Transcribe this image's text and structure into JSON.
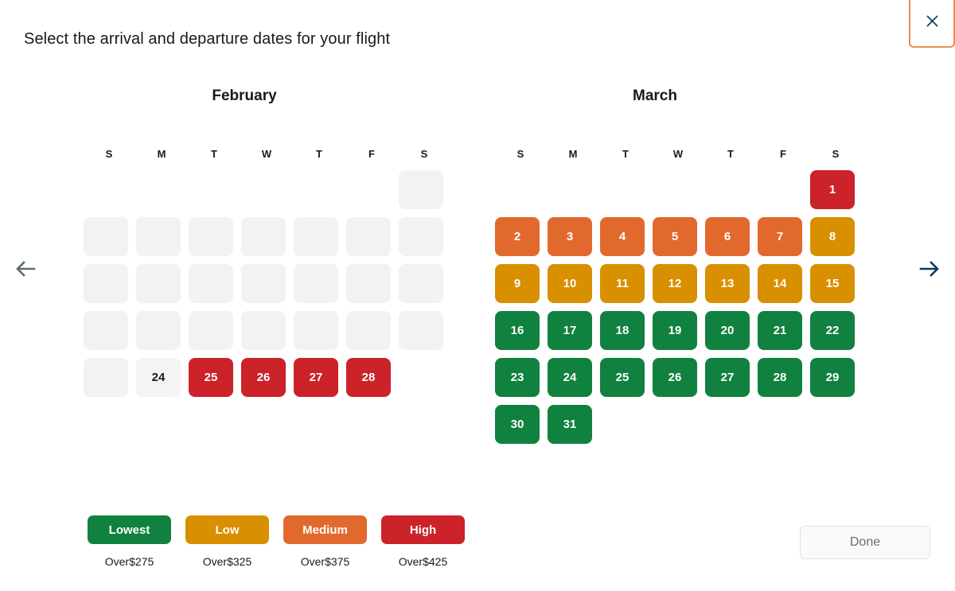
{
  "dialog": {
    "title": "Select the arrival and departure dates for your flight",
    "close_label": "×",
    "done_label": "Done"
  },
  "nav": {
    "prev_label": "←",
    "next_label": "→",
    "prev_enabled": false,
    "next_enabled": true
  },
  "colors": {
    "lowest": "#118140",
    "low": "#d88f00",
    "medium": "#e2692e",
    "high": "#cc2229",
    "empty": "#f2f2f2",
    "disabled_bg": "#f4f4f4",
    "close_border": "#ec8a52",
    "arrow_active": "#0f3c5c",
    "arrow_disabled": "#5f6b6d"
  },
  "weekdays": [
    "S",
    "M",
    "T",
    "W",
    "T",
    "F",
    "S"
  ],
  "months": [
    {
      "name": "February",
      "cells": [
        {
          "label": "",
          "state": "blank"
        },
        {
          "label": "",
          "state": "blank"
        },
        {
          "label": "",
          "state": "blank"
        },
        {
          "label": "",
          "state": "blank"
        },
        {
          "label": "",
          "state": "blank"
        },
        {
          "label": "",
          "state": "blank"
        },
        {
          "label": "",
          "state": "empty"
        },
        {
          "label": "",
          "state": "empty"
        },
        {
          "label": "",
          "state": "empty"
        },
        {
          "label": "",
          "state": "empty"
        },
        {
          "label": "",
          "state": "empty"
        },
        {
          "label": "",
          "state": "empty"
        },
        {
          "label": "",
          "state": "empty"
        },
        {
          "label": "",
          "state": "empty"
        },
        {
          "label": "",
          "state": "empty"
        },
        {
          "label": "",
          "state": "empty"
        },
        {
          "label": "",
          "state": "empty"
        },
        {
          "label": "",
          "state": "empty"
        },
        {
          "label": "",
          "state": "empty"
        },
        {
          "label": "",
          "state": "empty"
        },
        {
          "label": "",
          "state": "empty"
        },
        {
          "label": "",
          "state": "empty"
        },
        {
          "label": "",
          "state": "empty"
        },
        {
          "label": "",
          "state": "empty"
        },
        {
          "label": "",
          "state": "empty"
        },
        {
          "label": "",
          "state": "empty"
        },
        {
          "label": "",
          "state": "empty"
        },
        {
          "label": "",
          "state": "empty"
        },
        {
          "label": "",
          "state": "empty"
        },
        {
          "label": "24",
          "state": "disabled"
        },
        {
          "label": "25",
          "state": "high"
        },
        {
          "label": "26",
          "state": "high"
        },
        {
          "label": "27",
          "state": "high"
        },
        {
          "label": "28",
          "state": "high"
        },
        {
          "label": "",
          "state": "blank"
        }
      ]
    },
    {
      "name": "March",
      "cells": [
        {
          "label": "",
          "state": "blank"
        },
        {
          "label": "",
          "state": "blank"
        },
        {
          "label": "",
          "state": "blank"
        },
        {
          "label": "",
          "state": "blank"
        },
        {
          "label": "",
          "state": "blank"
        },
        {
          "label": "",
          "state": "blank"
        },
        {
          "label": "1",
          "state": "high"
        },
        {
          "label": "2",
          "state": "medium"
        },
        {
          "label": "3",
          "state": "medium"
        },
        {
          "label": "4",
          "state": "medium"
        },
        {
          "label": "5",
          "state": "medium"
        },
        {
          "label": "6",
          "state": "medium"
        },
        {
          "label": "7",
          "state": "medium"
        },
        {
          "label": "8",
          "state": "low"
        },
        {
          "label": "9",
          "state": "low"
        },
        {
          "label": "10",
          "state": "low"
        },
        {
          "label": "11",
          "state": "low"
        },
        {
          "label": "12",
          "state": "low"
        },
        {
          "label": "13",
          "state": "low"
        },
        {
          "label": "14",
          "state": "low"
        },
        {
          "label": "15",
          "state": "low"
        },
        {
          "label": "16",
          "state": "lowest"
        },
        {
          "label": "17",
          "state": "lowest"
        },
        {
          "label": "18",
          "state": "lowest"
        },
        {
          "label": "19",
          "state": "lowest"
        },
        {
          "label": "20",
          "state": "lowest"
        },
        {
          "label": "21",
          "state": "lowest"
        },
        {
          "label": "22",
          "state": "lowest"
        },
        {
          "label": "23",
          "state": "lowest"
        },
        {
          "label": "24",
          "state": "lowest"
        },
        {
          "label": "25",
          "state": "lowest"
        },
        {
          "label": "26",
          "state": "lowest"
        },
        {
          "label": "27",
          "state": "lowest"
        },
        {
          "label": "28",
          "state": "lowest"
        },
        {
          "label": "29",
          "state": "lowest"
        },
        {
          "label": "30",
          "state": "lowest"
        },
        {
          "label": "31",
          "state": "lowest"
        },
        {
          "label": "",
          "state": "blank"
        },
        {
          "label": "",
          "state": "blank"
        },
        {
          "label": "",
          "state": "blank"
        },
        {
          "label": "",
          "state": "blank"
        },
        {
          "label": "",
          "state": "blank"
        }
      ]
    }
  ],
  "legend": [
    {
      "label": "Lowest",
      "price": "Over$275",
      "state": "lowest"
    },
    {
      "label": "Low",
      "price": "Over$325",
      "state": "low"
    },
    {
      "label": "Medium",
      "price": "Over$375",
      "state": "medium"
    },
    {
      "label": "High",
      "price": "Over$425",
      "state": "high"
    }
  ]
}
